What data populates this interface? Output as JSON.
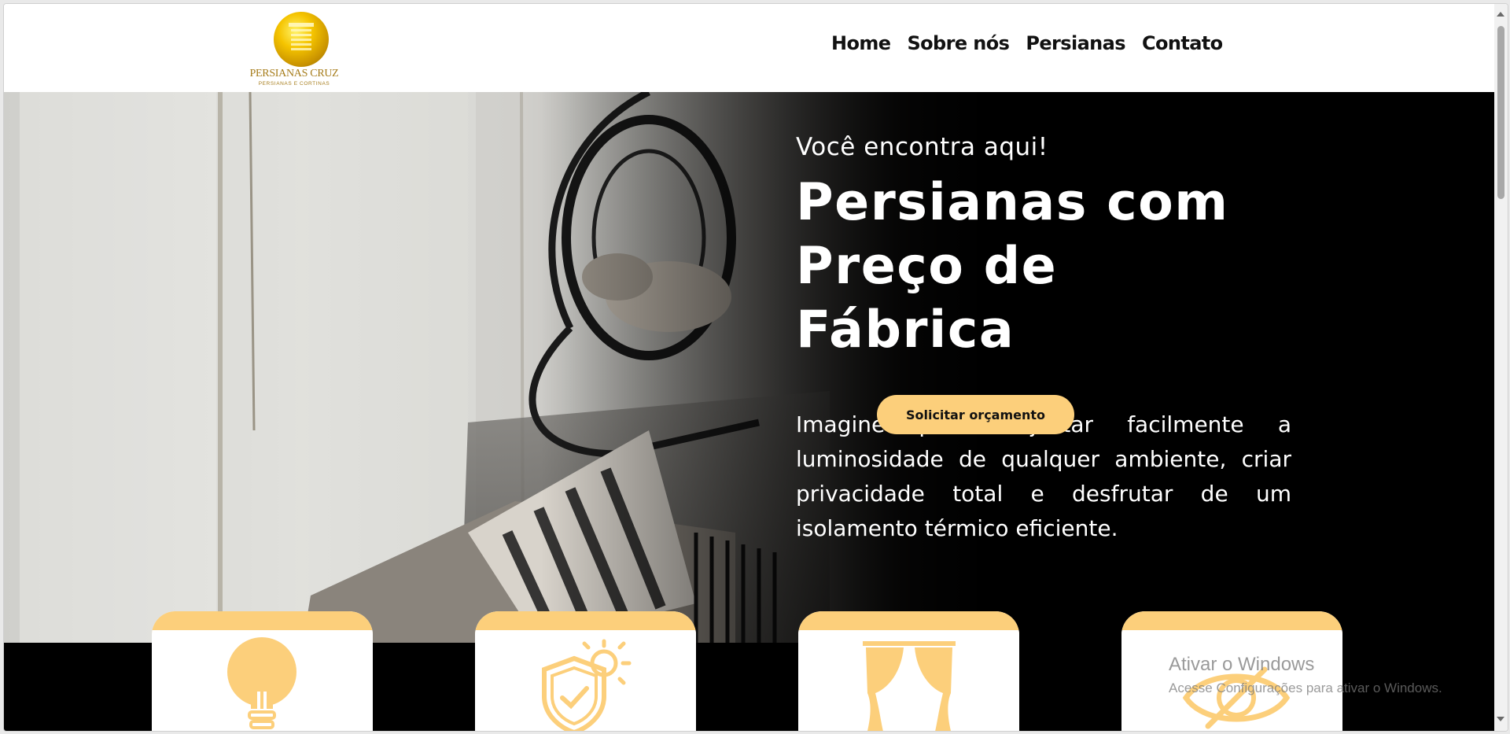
{
  "header": {
    "logo_title": "PERSIANAS CRUZ",
    "logo_subtitle": "PERSIANAS E CORTINAS",
    "nav": [
      "Home",
      "Sobre nós",
      "Persianas",
      "Contato"
    ]
  },
  "hero": {
    "tagline": "Você encontra aqui!",
    "title_line1": "Persianas com",
    "title_line2": "Preço de Fábrica",
    "description": "Imagine poder ajustar facilmente a luminosidade de qualquer ambiente, criar privacidade total e desfrutar de um isolamento térmico eficiente.",
    "cta_label": "Solicitar orçamento"
  },
  "features": [
    {
      "icon": "light-bulb-icon"
    },
    {
      "icon": "shield-check-sun-icon"
    },
    {
      "icon": "curtain-icon"
    },
    {
      "icon": "eye-slash-icon"
    }
  ],
  "watermark": {
    "title": "Ativar o Windows",
    "subtitle": "Acesse Configurações para ativar o Windows."
  },
  "colors": {
    "accent": "#fccf7b",
    "gold": "#a67c1a",
    "dark": "#000000"
  }
}
